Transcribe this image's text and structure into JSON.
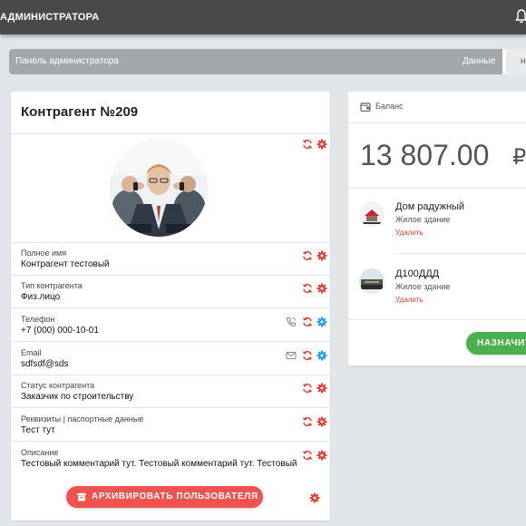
{
  "header": {
    "title": "АДМИНИСТРАТОРА"
  },
  "breadcrumbs": {
    "items": [
      "Панель администратора",
      "Данные",
      "на р"
    ]
  },
  "profile": {
    "title": "Контрагент №209",
    "fields": [
      {
        "label": "Полное имя",
        "value": "Контрагент тестовый",
        "extra_icon": null
      },
      {
        "label": "Тип контрагента",
        "value": "Физ.лицо",
        "extra_icon": null
      },
      {
        "label": "Телефон",
        "value": "+7 (000) 000-10-01",
        "extra_icon": "phone-icon"
      },
      {
        "label": "Email",
        "value": "sdfsdf@sds",
        "extra_icon": "mail-icon"
      },
      {
        "label": "Статус контрагента",
        "value": "Заказчик по строительству",
        "extra_icon": null
      },
      {
        "label": "Реквизиты | паспортные данные",
        "value": "Тест тут",
        "extra_icon": null
      },
      {
        "label": "Описание",
        "value": "Тестовый комментарий тут. Тестовый комментарий тут. Тестовый комментарий тут.",
        "extra_icon": null
      }
    ],
    "archive_button": "АРХИВИРОВАТЬ ПОЛЬЗОВАТЕЛЯ"
  },
  "balance": {
    "title": "Баланс",
    "amount": "13 807.00",
    "currency": "₽",
    "properties": [
      {
        "name": "Дом радужный",
        "type": "Жилое здание",
        "action": "Удалить"
      },
      {
        "name": "Д100ДДД",
        "type": "Жилое здание",
        "action": "Удалить"
      }
    ],
    "assign_button": "НАЗНАЧИТЬ"
  },
  "colors": {
    "topbar": "#4a4a4a",
    "accent_red": "#ef5350",
    "accent_blue": "#2196f3",
    "accent_green": "#4caf50",
    "background": "#e3e6e9"
  }
}
